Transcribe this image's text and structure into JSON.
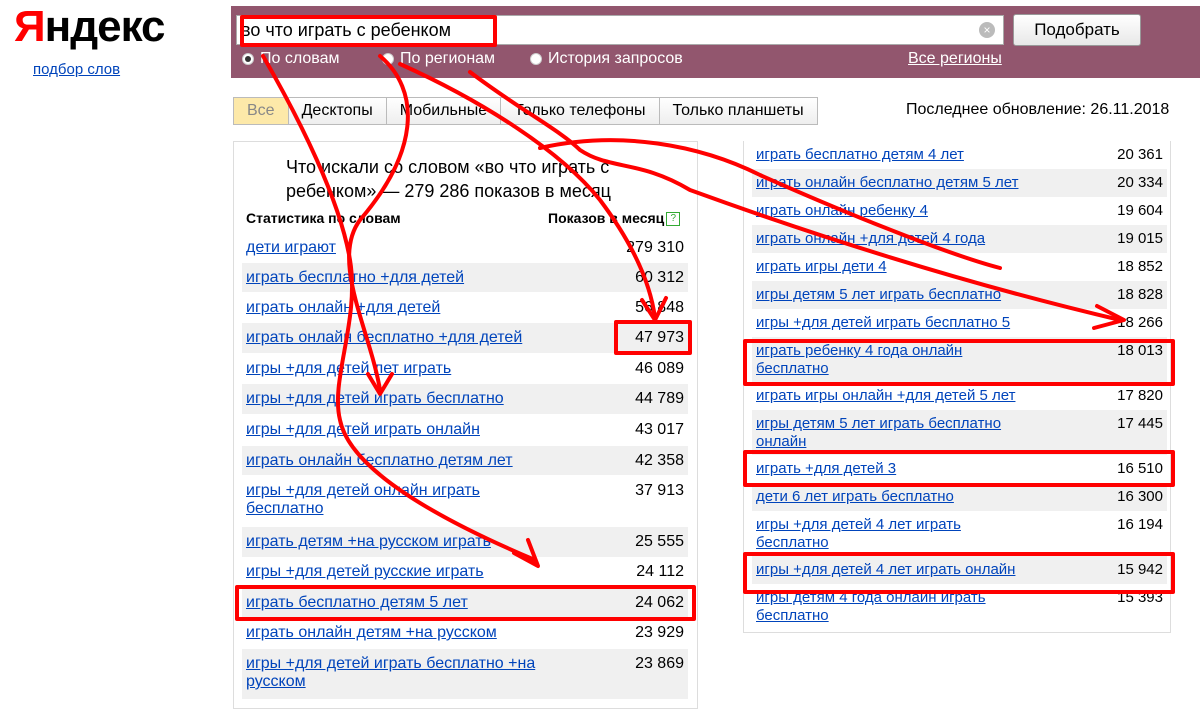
{
  "logo": {
    "first_letter": "Я",
    "rest": "ндекс",
    "subtitle": "подбор слов"
  },
  "search": {
    "value": "во что играть с ребенком",
    "button_label": "Подобрать"
  },
  "radios": [
    {
      "label": "По словам",
      "checked": true
    },
    {
      "label": "По регионам",
      "checked": false
    },
    {
      "label": "История запросов",
      "checked": false
    }
  ],
  "regions_link": "Все регионы",
  "tabs": [
    "Все",
    "Десктопы",
    "Мобильные",
    "Только телефоны",
    "Только планшеты"
  ],
  "last_update": "Последнее обновление: 26.11.2018",
  "left": {
    "heading": "Что искали со словом «во что играть с ребенком» — 279 286 показов в месяц",
    "col_keyword": "Статистика по словам",
    "col_views": "Показов в месяц",
    "rows": [
      {
        "kw": "дети играют",
        "n": "279 310"
      },
      {
        "kw": "играть бесплатно +для детей",
        "n": "60 312"
      },
      {
        "kw": "играть онлайн +для детей",
        "n": "56 848"
      },
      {
        "kw": "играть онлайн бесплатно +для детей",
        "n": "47 973"
      },
      {
        "kw": "игры +для детей лет играть",
        "n": "46 089"
      },
      {
        "kw": "игры +для детей играть бесплатно",
        "n": "44 789"
      },
      {
        "kw": "игры +для детей играть онлайн",
        "n": "43 017"
      },
      {
        "kw": "играть онлайн бесплатно детям лет",
        "n": "42 358"
      },
      {
        "kw": "игры +для детей онлайн играть бесплатно",
        "n": "37 913"
      },
      {
        "kw": "играть детям +на русском играть",
        "n": "25 555"
      },
      {
        "kw": "игры +для детей русские играть",
        "n": "24 112"
      },
      {
        "kw": "играть бесплатно детям 5 лет",
        "n": "24 062"
      },
      {
        "kw": "играть онлайн детям +на русском",
        "n": "23 929"
      },
      {
        "kw": "игры +для детей играть бесплатно +на русском",
        "n": "23 869"
      }
    ]
  },
  "right": {
    "rows": [
      {
        "kw": "играть бесплатно детям 4 лет",
        "n": "20 361"
      },
      {
        "kw": "играть онлайн бесплатно детям 5 лет",
        "n": "20 334"
      },
      {
        "kw": "играть онлайн ребенку 4",
        "n": "19 604"
      },
      {
        "kw": "играть онлайн +для детей 4 года",
        "n": "19 015"
      },
      {
        "kw": "играть игры дети 4",
        "n": "18 852"
      },
      {
        "kw": "игры детям 5 лет играть бесплатно",
        "n": "18 828"
      },
      {
        "kw": "игры +для детей играть бесплатно 5",
        "n": "18 266"
      },
      {
        "kw": "играть ребенку 4 года онлайн бесплатно",
        "n": "18 013"
      },
      {
        "kw": "играть игры онлайн +для детей 5 лет",
        "n": "17 820"
      },
      {
        "kw": "игры детям 5 лет играть бесплатно онлайн",
        "n": "17 445"
      },
      {
        "kw": "играть +для детей 3",
        "n": "16 510"
      },
      {
        "kw": "дети 6 лет играть бесплатно",
        "n": "16 300"
      },
      {
        "kw": "игры +для детей 4 лет играть бесплатно",
        "n": "16 194"
      },
      {
        "kw": "игры +для детей 4 лет играть онлайн",
        "n": "15 942"
      },
      {
        "kw": "игры детям 4 года онлайн играть бесплатно",
        "n": "15 393"
      }
    ]
  },
  "annotation_color": "#ff0000"
}
